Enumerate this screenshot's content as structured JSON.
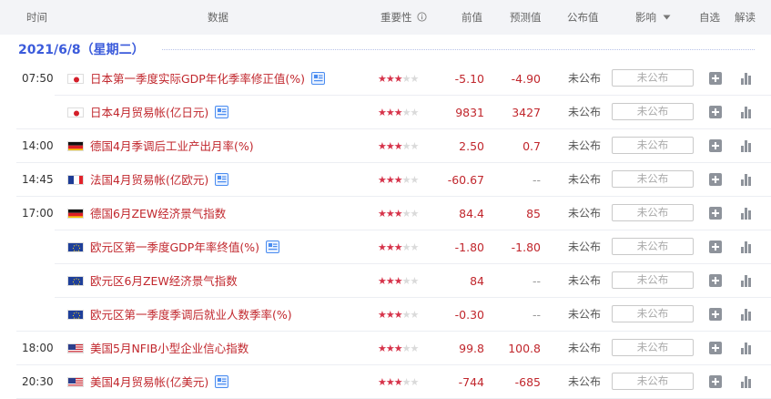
{
  "header": {
    "time": "时间",
    "data": "数据",
    "importance": "重要性",
    "previous": "前值",
    "forecast": "预测值",
    "published": "公布值",
    "impact": "影响",
    "watchlist": "自选",
    "interpretation": "解读"
  },
  "date_label": "2021/6/8（星期二）",
  "colors": {
    "accent": "#3b5bdb",
    "value_red": "#c1272d",
    "star_on": "#d6334a",
    "icon_gray": "#8e939b"
  },
  "rows": [
    {
      "time": "07:50",
      "flag": "jp",
      "title": "日本第一季度实际GDP年化季率修正值(%)",
      "info": true,
      "stars": 3,
      "previous": "-5.10",
      "forecast": "-4.90",
      "published": "未公布",
      "box": "未公布"
    },
    {
      "time": "",
      "flag": "jp",
      "title": "日本4月贸易帐(亿日元)",
      "info": true,
      "stars": 3,
      "previous": "9831",
      "forecast": "3427",
      "published": "未公布",
      "box": "未公布"
    },
    {
      "time": "14:00",
      "flag": "de",
      "title": "德国4月季调后工业产出月率(%)",
      "info": false,
      "stars": 3,
      "previous": "2.50",
      "forecast": "0.7",
      "published": "未公布",
      "box": "未公布"
    },
    {
      "time": "14:45",
      "flag": "fr",
      "title": "法国4月贸易帐(亿欧元)",
      "info": true,
      "stars": 3,
      "previous": "-60.67",
      "forecast": "--",
      "published": "未公布",
      "box": "未公布"
    },
    {
      "time": "17:00",
      "flag": "de",
      "title": "德国6月ZEW经济景气指数",
      "info": false,
      "stars": 3,
      "previous": "84.4",
      "forecast": "85",
      "published": "未公布",
      "box": "未公布"
    },
    {
      "time": "",
      "flag": "eu",
      "title": "欧元区第一季度GDP年率终值(%)",
      "info": true,
      "stars": 3,
      "previous": "-1.80",
      "forecast": "-1.80",
      "published": "未公布",
      "box": "未公布"
    },
    {
      "time": "",
      "flag": "eu",
      "title": "欧元区6月ZEW经济景气指数",
      "info": false,
      "stars": 3,
      "previous": "84",
      "forecast": "--",
      "published": "未公布",
      "box": "未公布"
    },
    {
      "time": "",
      "flag": "eu",
      "title": "欧元区第一季度季调后就业人数季率(%)",
      "info": false,
      "stars": 3,
      "previous": "-0.30",
      "forecast": "--",
      "published": "未公布",
      "box": "未公布"
    },
    {
      "time": "18:00",
      "flag": "us",
      "title": "美国5月NFIB小型企业信心指数",
      "info": false,
      "stars": 3,
      "previous": "99.8",
      "forecast": "100.8",
      "published": "未公布",
      "box": "未公布"
    },
    {
      "time": "20:30",
      "flag": "us",
      "title": "美国4月贸易帐(亿美元)",
      "info": true,
      "stars": 3,
      "previous": "-744",
      "forecast": "-685",
      "published": "未公布",
      "box": "未公布"
    }
  ]
}
